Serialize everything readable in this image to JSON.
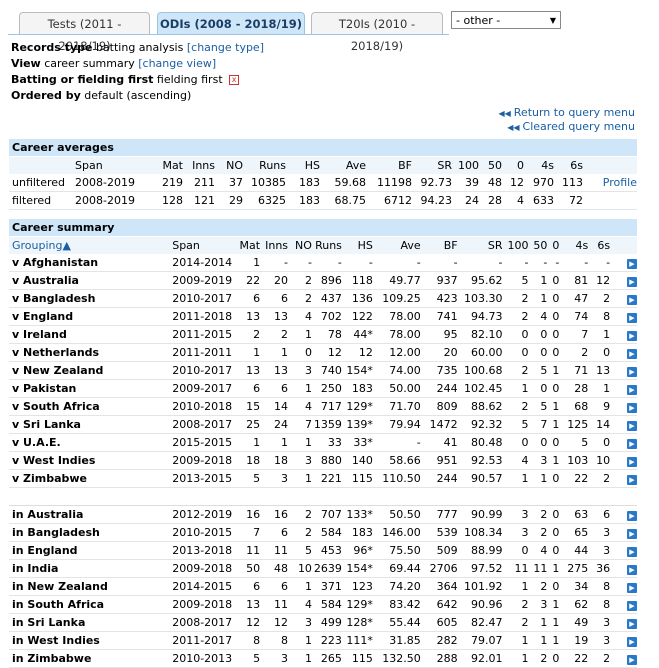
{
  "tabs": [
    {
      "label": "Tests (2011 - 2018/19)"
    },
    {
      "label": "ODIs (2008 - 2018/19)"
    },
    {
      "label": "T20Is (2010 - 2018/19)"
    }
  ],
  "other_select": "- other -",
  "records_type": {
    "label": "Records type",
    "value": "batting analysis",
    "link": "[change type]"
  },
  "view": {
    "label": "View",
    "value": "career summary",
    "link": "[change view]"
  },
  "batting_first": {
    "label": "Batting or fielding first",
    "value": "fielding first"
  },
  "ordered_by": {
    "label": "Ordered by",
    "value": "default (ascending)"
  },
  "links": {
    "return": "Return to query menu",
    "cleared": "Cleared query menu"
  },
  "averages": {
    "title": "Career averages",
    "columns": [
      "Span",
      "Mat",
      "Inns",
      "NO",
      "Runs",
      "HS",
      "Ave",
      "BF",
      "SR",
      "100",
      "50",
      "0",
      "4s",
      "6s"
    ],
    "rows": [
      {
        "label": "unfiltered",
        "cells": [
          "2008-2019",
          "219",
          "211",
          "37",
          "10385",
          "183",
          "59.68",
          "11198",
          "92.73",
          "39",
          "48",
          "12",
          "970",
          "113"
        ],
        "link": "Profile"
      },
      {
        "label": "filtered",
        "cells": [
          "2008-2019",
          "128",
          "121",
          "29",
          "6325",
          "183",
          "68.75",
          "6712",
          "94.23",
          "24",
          "28",
          "4",
          "633",
          "72"
        ],
        "link": ""
      }
    ]
  },
  "summary": {
    "title": "Career summary",
    "columns": [
      "Grouping▲",
      "Span",
      "Mat",
      "Inns",
      "NO",
      "Runs",
      "HS",
      "Ave",
      "BF",
      "SR",
      "100",
      "50",
      "0",
      "4s",
      "6s"
    ],
    "opposition": [
      [
        "v Afghanistan",
        "2014-2014",
        "1",
        "-",
        "-",
        "-",
        "-",
        "-",
        "-",
        "-",
        "-",
        "-",
        "-",
        "-",
        "-"
      ],
      [
        "v Australia",
        "2009-2019",
        "22",
        "20",
        "2",
        "896",
        "118",
        "49.77",
        "937",
        "95.62",
        "5",
        "1",
        "0",
        "81",
        "12"
      ],
      [
        "v Bangladesh",
        "2010-2017",
        "6",
        "6",
        "2",
        "437",
        "136",
        "109.25",
        "423",
        "103.30",
        "2",
        "1",
        "0",
        "47",
        "2"
      ],
      [
        "v England",
        "2011-2018",
        "13",
        "13",
        "4",
        "702",
        "122",
        "78.00",
        "741",
        "94.73",
        "2",
        "4",
        "0",
        "74",
        "8"
      ],
      [
        "v Ireland",
        "2011-2015",
        "2",
        "2",
        "1",
        "78",
        "44*",
        "78.00",
        "95",
        "82.10",
        "0",
        "0",
        "0",
        "7",
        "1"
      ],
      [
        "v Netherlands",
        "2011-2011",
        "1",
        "1",
        "0",
        "12",
        "12",
        "12.00",
        "20",
        "60.00",
        "0",
        "0",
        "0",
        "2",
        "0"
      ],
      [
        "v New Zealand",
        "2010-2017",
        "13",
        "13",
        "3",
        "740",
        "154*",
        "74.00",
        "735",
        "100.68",
        "2",
        "5",
        "1",
        "71",
        "13"
      ],
      [
        "v Pakistan",
        "2009-2017",
        "6",
        "6",
        "1",
        "250",
        "183",
        "50.00",
        "244",
        "102.45",
        "1",
        "0",
        "0",
        "28",
        "1"
      ],
      [
        "v South Africa",
        "2010-2018",
        "15",
        "14",
        "4",
        "717",
        "129*",
        "71.70",
        "809",
        "88.62",
        "2",
        "5",
        "1",
        "68",
        "9"
      ],
      [
        "v Sri Lanka",
        "2008-2017",
        "25",
        "24",
        "7",
        "1359",
        "139*",
        "79.94",
        "1472",
        "92.32",
        "5",
        "7",
        "1",
        "125",
        "14"
      ],
      [
        "v U.A.E.",
        "2015-2015",
        "1",
        "1",
        "1",
        "33",
        "33*",
        "-",
        "41",
        "80.48",
        "0",
        "0",
        "0",
        "5",
        "0"
      ],
      [
        "v West Indies",
        "2009-2018",
        "18",
        "18",
        "3",
        "880",
        "140",
        "58.66",
        "951",
        "92.53",
        "4",
        "3",
        "1",
        "103",
        "10"
      ],
      [
        "v Zimbabwe",
        "2013-2015",
        "5",
        "3",
        "1",
        "221",
        "115",
        "110.50",
        "244",
        "90.57",
        "1",
        "1",
        "0",
        "22",
        "2"
      ]
    ],
    "host": [
      [
        "in Australia",
        "2012-2019",
        "16",
        "16",
        "2",
        "707",
        "133*",
        "50.50",
        "777",
        "90.99",
        "3",
        "2",
        "0",
        "63",
        "6"
      ],
      [
        "in Bangladesh",
        "2010-2015",
        "7",
        "6",
        "2",
        "584",
        "183",
        "146.00",
        "539",
        "108.34",
        "3",
        "2",
        "0",
        "65",
        "3"
      ],
      [
        "in England",
        "2013-2018",
        "11",
        "11",
        "5",
        "453",
        "96*",
        "75.50",
        "509",
        "88.99",
        "0",
        "4",
        "0",
        "44",
        "3"
      ],
      [
        "in India",
        "2009-2018",
        "50",
        "48",
        "10",
        "2639",
        "154*",
        "69.44",
        "2706",
        "97.52",
        "11",
        "11",
        "1",
        "275",
        "36"
      ],
      [
        "in New Zealand",
        "2014-2015",
        "6",
        "6",
        "1",
        "371",
        "123",
        "74.20",
        "364",
        "101.92",
        "1",
        "2",
        "0",
        "34",
        "8"
      ],
      [
        "in South Africa",
        "2009-2018",
        "13",
        "11",
        "4",
        "584",
        "129*",
        "83.42",
        "642",
        "90.96",
        "2",
        "3",
        "1",
        "62",
        "8"
      ],
      [
        "in Sri Lanka",
        "2008-2017",
        "12",
        "12",
        "3",
        "499",
        "128*",
        "55.44",
        "605",
        "82.47",
        "2",
        "1",
        "1",
        "49",
        "3"
      ],
      [
        "in West Indies",
        "2011-2017",
        "8",
        "8",
        "1",
        "223",
        "111*",
        "31.85",
        "282",
        "79.07",
        "1",
        "1",
        "1",
        "19",
        "3"
      ],
      [
        "in Zimbabwe",
        "2010-2013",
        "5",
        "3",
        "1",
        "265",
        "115",
        "132.50",
        "288",
        "92.01",
        "1",
        "2",
        "0",
        "22",
        "2"
      ]
    ]
  }
}
